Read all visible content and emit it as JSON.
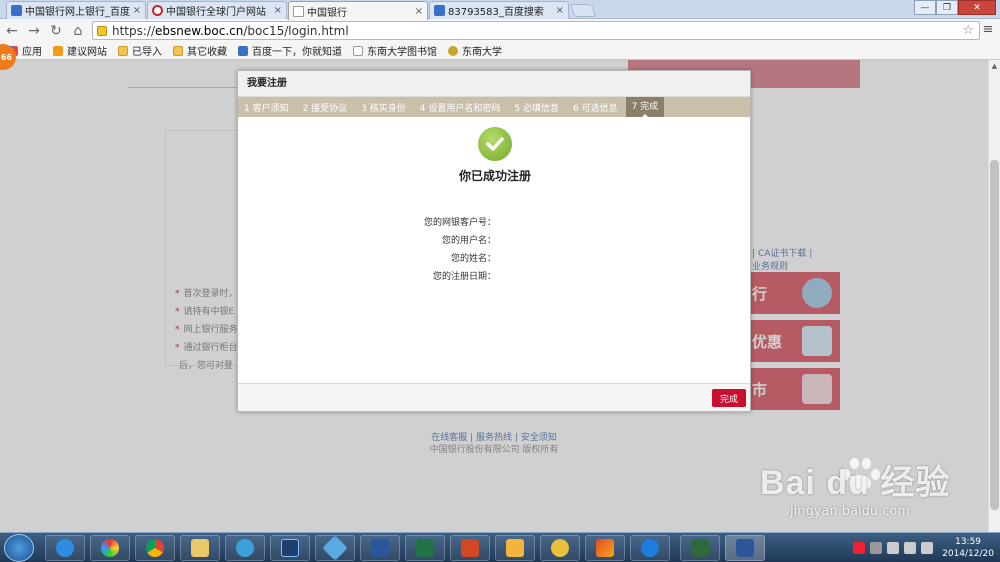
{
  "browser": {
    "tabs": [
      {
        "title": "中国银行网上银行_百度搜",
        "icon": "baidu-icon",
        "active": false
      },
      {
        "title": "中国银行全球门户网站",
        "icon": "boc-icon",
        "active": false
      },
      {
        "title": "中国银行",
        "icon": "page-icon",
        "active": true
      },
      {
        "title": "83793583_百度搜索",
        "icon": "baidu-icon",
        "active": false
      }
    ],
    "close_glyph": "×",
    "url_scheme": "https://",
    "url_host": "ebsnew.boc.cn",
    "url_path": "/boc15/login.html",
    "bookmarks": [
      {
        "label": "应用",
        "icon": "apps-icon"
      },
      {
        "label": "建议网站",
        "icon": "suggest-icon"
      },
      {
        "label": "已导入",
        "icon": "folder-icon"
      },
      {
        "label": "其它收藏",
        "icon": "folder-icon"
      },
      {
        "label": "百度一下，你就知道",
        "icon": "baidu-icon"
      },
      {
        "label": "东南大学图书馆",
        "icon": "page-icon"
      },
      {
        "label": "东南大学",
        "icon": "seal-icon"
      }
    ],
    "badge": "66"
  },
  "page": {
    "bullets": [
      "首次登录时，",
      "请持有中银E",
      "网上银行服务",
      "通过银行柜台",
      "后，您可对登"
    ],
    "right_link_1": "CA证书下载",
    "right_text": "业务规则",
    "promo_1": "行",
    "promo_2": "优惠",
    "promo_3": "市",
    "footer_links": "在线客服 | 服务热线 | 安全须知",
    "footer_copy": "中国银行股份有限公司  版权所有"
  },
  "modal": {
    "title": "我要注册",
    "steps": [
      "1 客户须知",
      "2 接受协议",
      "3 核实身份",
      "4 设置用户名和密码",
      "5 必填信息",
      "6 可选信息",
      "7 完成"
    ],
    "active_step": 6,
    "success_message": "你已成功注册",
    "fields": [
      {
        "label": "您的网银客户号：",
        "value": ""
      },
      {
        "label": "您的用户名：",
        "value": ""
      },
      {
        "label": "您的姓名：",
        "value": ""
      },
      {
        "label": "您的注册日期：",
        "value": ""
      }
    ],
    "done_button": "完成"
  },
  "watermark": {
    "brand": "Bai du 经验",
    "url": "jingyan.baidu.com"
  },
  "taskbar": {
    "time": "13:59",
    "date": "2014/12/20"
  },
  "colors": {
    "boc_red": "#c8102e",
    "step_bar": "#c9c0a9",
    "step_active": "#8a7f68"
  }
}
